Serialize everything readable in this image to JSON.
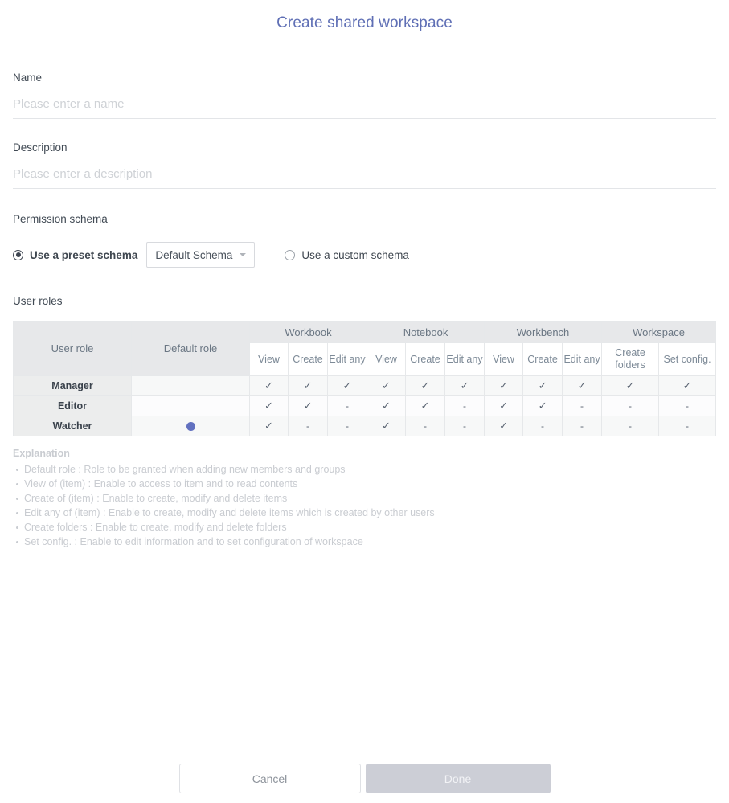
{
  "dialog": {
    "title": "Create shared workspace"
  },
  "fields": {
    "name": {
      "label": "Name",
      "value": "",
      "placeholder": "Please enter a name"
    },
    "description": {
      "label": "Description",
      "value": "",
      "placeholder": "Please enter a description"
    }
  },
  "permission_schema": {
    "label": "Permission schema",
    "preset_option": "Use a preset schema",
    "preset_selected": true,
    "schema_value": "Default Schema",
    "custom_option": "Use a custom schema",
    "custom_selected": false
  },
  "user_roles": {
    "label": "User roles",
    "columns": {
      "user_role": "User role",
      "default_role": "Default role",
      "groups": [
        {
          "name": "Workbook",
          "subs": [
            "View",
            "Create",
            "Edit any"
          ]
        },
        {
          "name": "Notebook",
          "subs": [
            "View",
            "Create",
            "Edit any"
          ]
        },
        {
          "name": "Workbench",
          "subs": [
            "View",
            "Create",
            "Edit any"
          ]
        },
        {
          "name": "Workspace",
          "subs": [
            "Create folders",
            "Set config."
          ]
        }
      ]
    },
    "rows": [
      {
        "role": "Manager",
        "is_default": false,
        "permissions": [
          "check",
          "check",
          "check",
          "check",
          "check",
          "check",
          "check",
          "check",
          "check",
          "check",
          "check"
        ]
      },
      {
        "role": "Editor",
        "is_default": false,
        "permissions": [
          "check",
          "check",
          "dash",
          "check",
          "check",
          "dash",
          "check",
          "check",
          "dash",
          "dash",
          "dash"
        ]
      },
      {
        "role": "Watcher",
        "is_default": true,
        "permissions": [
          "check",
          "dash",
          "dash",
          "check",
          "dash",
          "dash",
          "check",
          "dash",
          "dash",
          "dash",
          "dash"
        ]
      }
    ]
  },
  "explanation": {
    "title": "Explanation",
    "items": [
      "Default role : Role to be granted when adding new members and groups",
      "View of (item) : Enable to access to item and to read contents",
      "Create of (item) : Enable to create, modify and delete items",
      "Edit any of (item) : Enable to create, modify and delete items which is created by other users",
      "Create folders : Enable to create, modify and delete folders",
      "Set config. : Enable to edit information and to set configuration of workspace"
    ]
  },
  "footer": {
    "cancel_label": "Cancel",
    "done_label": "Done",
    "done_disabled": true
  },
  "glyphs": {
    "check": "✓",
    "dash": "-"
  },
  "colors": {
    "title": "#5f6fb5",
    "default_role_dot": "#6271c0",
    "header_bg": "#e7e8ea",
    "done_bg": "#ccced6"
  }
}
